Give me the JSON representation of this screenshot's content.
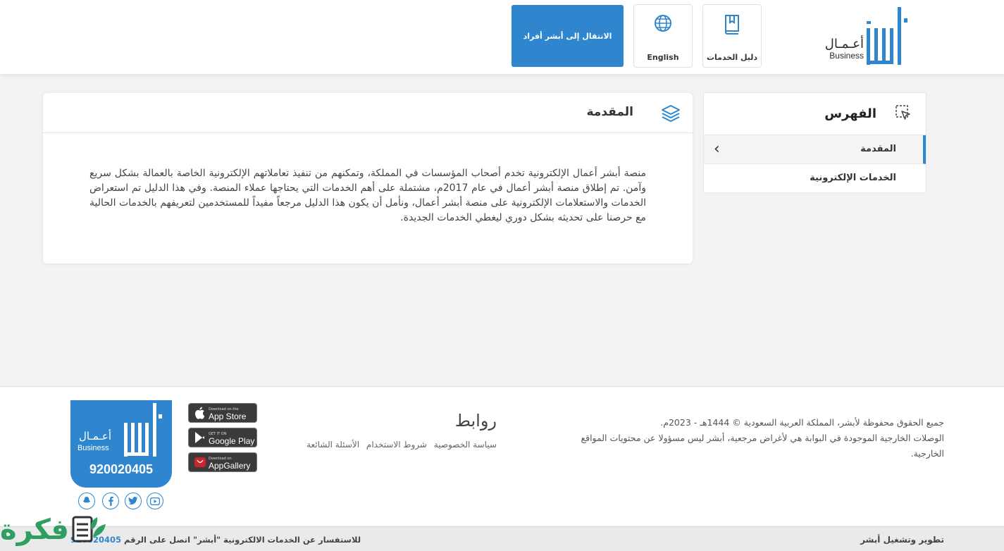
{
  "header": {
    "logo": {
      "text_ar": "أعـمـال",
      "text_en": "Business",
      "mark": "absher-logo"
    },
    "guide_button": {
      "label": "دليل الخدمات",
      "icon": "book-icon"
    },
    "english_button": {
      "label": "English",
      "icon": "globe-icon"
    },
    "individuals_button": {
      "label": "الانتقال إلى أبشر أفراد"
    }
  },
  "sidebar": {
    "title": "الفهرس",
    "icon": "cursor-select-icon",
    "items": [
      {
        "label": "المقدمة",
        "active": true
      },
      {
        "label": "الخدمات الإلكترونية",
        "active": false
      }
    ]
  },
  "main": {
    "title": "المقدمة",
    "icon": "layers-icon",
    "body": "منصة أبشر أعمال الإلكترونية تخدم أصحاب المؤسسات في المملكة، وتمكنهم من تنفيذ تعاملاتهم الإلكترونية الخاصة بالعمالة بشكل سريع وآمن. تم إطلاق منصة أبشر أعمال في عام 2017م، مشتملة على أهم الخدمات التي يحتاجها عملاء المنصة. وفي هذا الدليل تم استعراض الخدمات والاستعلامات الإلكترونية على منصة أبشر أعمال، ونأمل أن يكون هذا الدليل مرجعاً مفيداً للمستخدمين لتعريفهم بالخدمات الحالية مع حرصنا على تحديثه بشكل دوري ليغطي الخدمات الجديدة."
  },
  "footer": {
    "copyright": "جميع الحقوق محفوظة لأبشر، المملكة العربية السعودية © 1444هـ - 2023م.",
    "disclaimer": "الوصلات الخارجية الموجودة في البوابة هي لأغراض مرجعية، أبشر ليس مسؤولا عن محتويات المواقع الخارجية.",
    "links_title": "روابط",
    "links": [
      "سياسة الخصوصية",
      "شروط الاستخدام",
      "الأسئلة الشائعة"
    ],
    "stores": [
      {
        "small": "Download on the",
        "big": "App Store",
        "icon": "apple-icon"
      },
      {
        "small": "GET IT ON",
        "big": "Google Play",
        "icon": "google-play-icon"
      },
      {
        "small": "Download on",
        "big": "AppGallery",
        "icon": "huawei-icon"
      }
    ],
    "badge": {
      "text_ar": "أعـمـال",
      "text_en": "Business",
      "phone": "920020405"
    },
    "social": [
      "snapchat-icon",
      "facebook-icon",
      "twitter-icon",
      "youtube-icon"
    ],
    "developer": "تطوير وتشغيل أبشر",
    "inquiry_text": "للاستفسار عن الخدمات الالكترونية \"أبشر\" اتصل على الرقم",
    "inquiry_number": "920020405"
  },
  "watermark": {
    "text": "فكرة"
  },
  "colors": {
    "accent": "#2f86cf",
    "background": "#f3f3f3",
    "watermark": "#2e9e61"
  }
}
